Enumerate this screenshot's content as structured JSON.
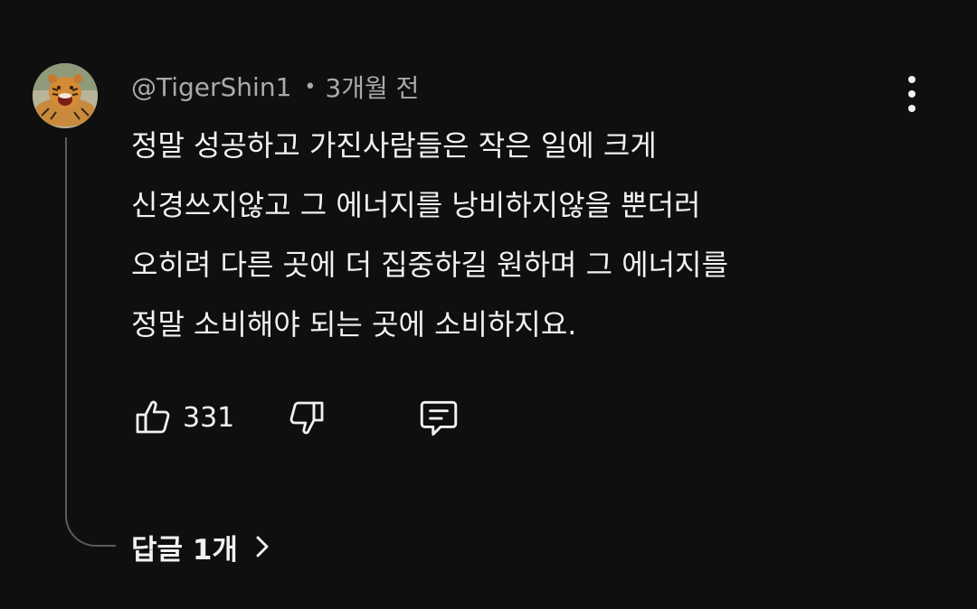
{
  "comment": {
    "author": "@TigerShin1",
    "separator": "•",
    "time": "3개월 전",
    "text_lines": [
      "정말 성공하고 가진사람들은 작은 일에 크게",
      "신경쓰지않고 그 에너지를 낭비하지않을 뿐더러",
      "오히려 다른 곳에 더 집중하길 원하며 그 에너지를",
      "정말 소비해야 되는 곳에 소비하지요."
    ],
    "like_count": "331",
    "replies_label": "답글 1개"
  },
  "icons": {
    "avatar": "tiger-avatar",
    "more": "more-vertical-icon",
    "like": "thumbs-up-icon",
    "dislike": "thumbs-down-icon",
    "reply": "comment-icon",
    "chevron": "chevron-right-icon"
  },
  "colors": {
    "background": "#0f0f0f",
    "text": "#f1f1f1",
    "secondary_text": "#aaaaaa",
    "thread_line": "#5c5c5c"
  }
}
